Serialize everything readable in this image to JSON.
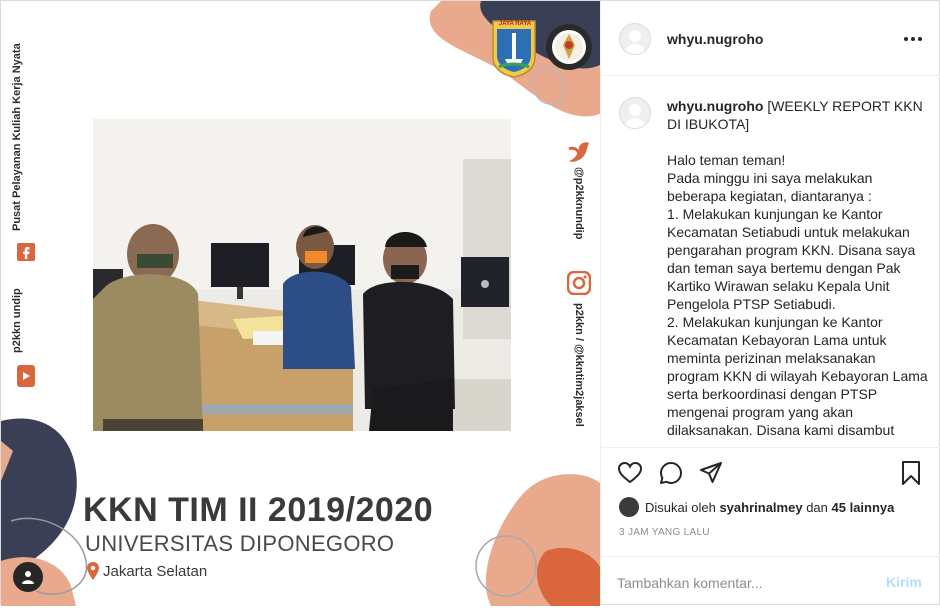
{
  "post": {
    "username": "whyu.nugroho",
    "left_strip": {
      "org": "Pusat Pelayanan Kuliah Kerja Nyata",
      "handle": "p2kkn undip"
    },
    "right_strip": {
      "handle1": "@p2kknundip",
      "handle2": "p2kkn / @kkntim2jaksel"
    },
    "logos": {
      "left_caption": "JAYA RAYA"
    },
    "title_main": "KKN TIM II 2019/2020",
    "title_sub": "UNIVERSITAS DIPONEGORO",
    "location": "Jakarta Selatan"
  },
  "caption": {
    "username": "whyu.nugroho",
    "headline": "[WEEKLY REPORT KKN DI IBUKOTA]",
    "body": "Halo teman teman!\nPada minggu ini saya melakukan beberapa kegiatan, diantaranya :\n1. Melakukan kunjungan ke Kantor Kecamatan Setiabudi untuk melakukan pengarahan program KKN. Disana saya dan teman saya bertemu dengan Pak Kartiko Wirawan selaku Kepala Unit Pengelola PTSP Setiabudi.\n2. Melakukan kunjungan ke Kantor Kecamatan Kebayoran Lama untuk meminta perizinan melaksanakan program KKN di wilayah Kebayoran Lama serta berkoordinasi dengan PTSP mengenai program yang akan dilaksanakan. Disana kami disambut"
  },
  "likes": {
    "prefix": "Disukai oleh",
    "user": "syahrinalmey",
    "conjunction": "dan",
    "others": "45 lainnya"
  },
  "time_ago": "3 JAM YANG LALU",
  "comment": {
    "placeholder": "Tambahkan komentar...",
    "post_label": "Kirim"
  },
  "icons": [
    "more-icon",
    "heart-icon",
    "comment-icon",
    "share-icon",
    "bookmark-icon",
    "user-tag-icon",
    "facebook-icon",
    "instagram-icon",
    "twitter-icon",
    "location-pin-icon"
  ],
  "colors": {
    "accent_orange": "#d9663c",
    "blob_navy": "#3a3f55",
    "blob_peach": "#f2c4ae",
    "post_button": "#b2dffc"
  }
}
